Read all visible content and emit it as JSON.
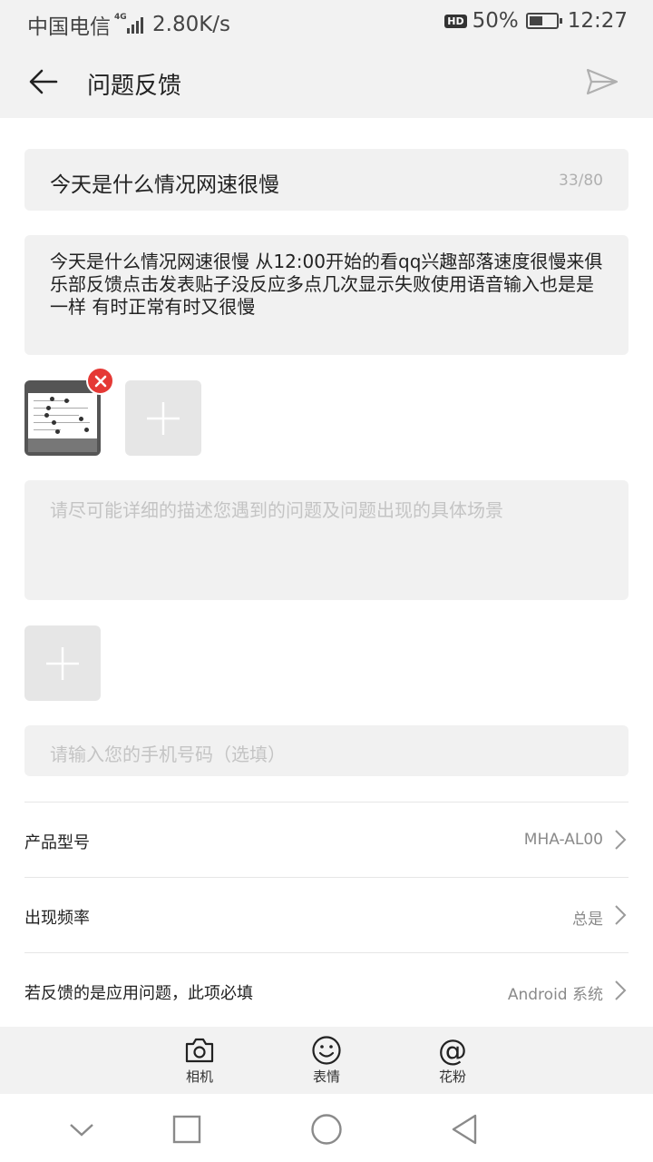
{
  "status_bar": {
    "carrier": "中国电信",
    "network_type": "4G",
    "speed": "2.80K/s",
    "hd_badge": "HD",
    "battery": "50%",
    "battery_level": 0.5,
    "time": "12:27"
  },
  "header": {
    "title": "问题反馈",
    "back_icon": "arrow-left-icon",
    "send_icon": "send-icon"
  },
  "form": {
    "title_value": "今天是什么情况网速很慢",
    "title_counter": "33/80",
    "description_value": "今天是什么情况网速很慢 从12:00开始的看qq兴趣部落速度很慢来俱乐部反馈点击发表贴子没反应多点几次显示失败使用语音输入也是是一样 有时正常有时又很慢",
    "detail_placeholder": "请尽可能详细的描述您遇到的问题及问题出现的具体场景",
    "phone_placeholder": "请输入您的手机号码（选填）"
  },
  "settings": [
    {
      "label": "产品型号",
      "value": "MHA-AL00"
    },
    {
      "label": "出现频率",
      "value": "总是"
    },
    {
      "label": "若反馈的是应用问题，此项必填",
      "value": "Android 系统"
    }
  ],
  "toolbar": {
    "camera_label": "相机",
    "emoji_label": "表情",
    "mention_label": "花粉",
    "mention_symbol": "@"
  },
  "colors": {
    "background": "#ffffff",
    "field_bg": "#f1f1f1",
    "bar_bg": "#f2f2f2",
    "delete_badge": "#e53935"
  }
}
